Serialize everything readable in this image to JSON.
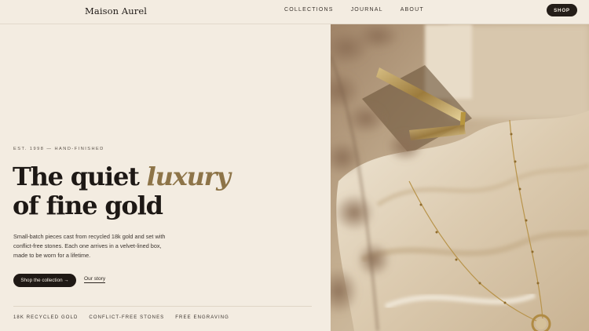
{
  "header": {
    "brand": "Maison Aurel",
    "nav": [
      "COLLECTIONS",
      "JOURNAL",
      "ABOUT"
    ],
    "shop_label": "SHOP"
  },
  "hero": {
    "eyebrow": "EST. 1998 — HAND-FINISHED",
    "headline_line1": "The quiet ",
    "headline_accent": "luxury",
    "headline_line2": "of fine gold",
    "body": "Small-batch pieces cast from recycled 18k gold and set with conflict-free stones. Each one arrives in a velvet-lined box, made to be worn for a lifetime.",
    "cta_primary": "Shop the collection →",
    "cta_secondary": "Our story",
    "features": [
      "18K RECYCLED GOLD",
      "CONFLICT-FREE STONES",
      "FREE ENGRAVING"
    ]
  },
  "colors": {
    "background": "#f3ece1",
    "ink": "#1f1a17",
    "accent_gold": "#8d7448",
    "button_dark": "#241d18"
  }
}
